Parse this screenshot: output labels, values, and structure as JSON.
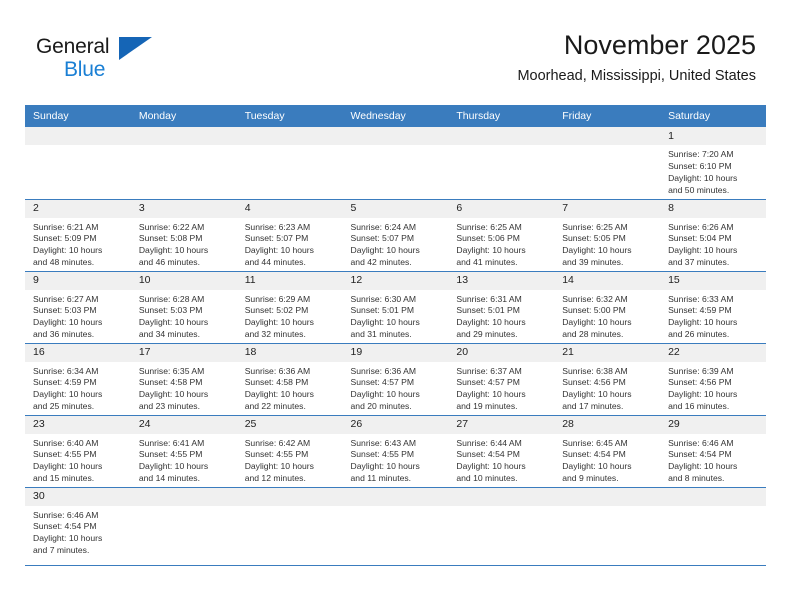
{
  "logo": {
    "word_top": "General",
    "word_bottom": "Blue",
    "triangle_icon": "blue-triangle-icon",
    "accent_dark": "#1565b6",
    "accent_light": "#1a7fd4"
  },
  "header": {
    "title": "November 2025",
    "subtitle": "Moorhead, Mississippi, United States"
  },
  "theme": {
    "header_row_bg": "#3a7cbe",
    "daynum_band_bg": "#f0f0f0",
    "row_border": "#3a7cbe",
    "text": "#333333"
  },
  "weekdays": [
    "Sunday",
    "Monday",
    "Tuesday",
    "Wednesday",
    "Thursday",
    "Friday",
    "Saturday"
  ],
  "labels": {
    "sunrise": "Sunrise:",
    "sunset": "Sunset:",
    "daylight": "Daylight:"
  },
  "weeks": [
    [
      {
        "day": "",
        "empty": true
      },
      {
        "day": "",
        "empty": true
      },
      {
        "day": "",
        "empty": true
      },
      {
        "day": "",
        "empty": true
      },
      {
        "day": "",
        "empty": true
      },
      {
        "day": "",
        "empty": true
      },
      {
        "day": "1",
        "sunrise": "Sunrise: 7:20 AM",
        "sunset": "Sunset: 6:10 PM",
        "daylight_1": "Daylight: 10 hours",
        "daylight_2": "and 50 minutes."
      }
    ],
    [
      {
        "day": "2",
        "sunrise": "Sunrise: 6:21 AM",
        "sunset": "Sunset: 5:09 PM",
        "daylight_1": "Daylight: 10 hours",
        "daylight_2": "and 48 minutes."
      },
      {
        "day": "3",
        "sunrise": "Sunrise: 6:22 AM",
        "sunset": "Sunset: 5:08 PM",
        "daylight_1": "Daylight: 10 hours",
        "daylight_2": "and 46 minutes."
      },
      {
        "day": "4",
        "sunrise": "Sunrise: 6:23 AM",
        "sunset": "Sunset: 5:07 PM",
        "daylight_1": "Daylight: 10 hours",
        "daylight_2": "and 44 minutes."
      },
      {
        "day": "5",
        "sunrise": "Sunrise: 6:24 AM",
        "sunset": "Sunset: 5:07 PM",
        "daylight_1": "Daylight: 10 hours",
        "daylight_2": "and 42 minutes."
      },
      {
        "day": "6",
        "sunrise": "Sunrise: 6:25 AM",
        "sunset": "Sunset: 5:06 PM",
        "daylight_1": "Daylight: 10 hours",
        "daylight_2": "and 41 minutes."
      },
      {
        "day": "7",
        "sunrise": "Sunrise: 6:25 AM",
        "sunset": "Sunset: 5:05 PM",
        "daylight_1": "Daylight: 10 hours",
        "daylight_2": "and 39 minutes."
      },
      {
        "day": "8",
        "sunrise": "Sunrise: 6:26 AM",
        "sunset": "Sunset: 5:04 PM",
        "daylight_1": "Daylight: 10 hours",
        "daylight_2": "and 37 minutes."
      }
    ],
    [
      {
        "day": "9",
        "sunrise": "Sunrise: 6:27 AM",
        "sunset": "Sunset: 5:03 PM",
        "daylight_1": "Daylight: 10 hours",
        "daylight_2": "and 36 minutes."
      },
      {
        "day": "10",
        "sunrise": "Sunrise: 6:28 AM",
        "sunset": "Sunset: 5:03 PM",
        "daylight_1": "Daylight: 10 hours",
        "daylight_2": "and 34 minutes."
      },
      {
        "day": "11",
        "sunrise": "Sunrise: 6:29 AM",
        "sunset": "Sunset: 5:02 PM",
        "daylight_1": "Daylight: 10 hours",
        "daylight_2": "and 32 minutes."
      },
      {
        "day": "12",
        "sunrise": "Sunrise: 6:30 AM",
        "sunset": "Sunset: 5:01 PM",
        "daylight_1": "Daylight: 10 hours",
        "daylight_2": "and 31 minutes."
      },
      {
        "day": "13",
        "sunrise": "Sunrise: 6:31 AM",
        "sunset": "Sunset: 5:01 PM",
        "daylight_1": "Daylight: 10 hours",
        "daylight_2": "and 29 minutes."
      },
      {
        "day": "14",
        "sunrise": "Sunrise: 6:32 AM",
        "sunset": "Sunset: 5:00 PM",
        "daylight_1": "Daylight: 10 hours",
        "daylight_2": "and 28 minutes."
      },
      {
        "day": "15",
        "sunrise": "Sunrise: 6:33 AM",
        "sunset": "Sunset: 4:59 PM",
        "daylight_1": "Daylight: 10 hours",
        "daylight_2": "and 26 minutes."
      }
    ],
    [
      {
        "day": "16",
        "sunrise": "Sunrise: 6:34 AM",
        "sunset": "Sunset: 4:59 PM",
        "daylight_1": "Daylight: 10 hours",
        "daylight_2": "and 25 minutes."
      },
      {
        "day": "17",
        "sunrise": "Sunrise: 6:35 AM",
        "sunset": "Sunset: 4:58 PM",
        "daylight_1": "Daylight: 10 hours",
        "daylight_2": "and 23 minutes."
      },
      {
        "day": "18",
        "sunrise": "Sunrise: 6:36 AM",
        "sunset": "Sunset: 4:58 PM",
        "daylight_1": "Daylight: 10 hours",
        "daylight_2": "and 22 minutes."
      },
      {
        "day": "19",
        "sunrise": "Sunrise: 6:36 AM",
        "sunset": "Sunset: 4:57 PM",
        "daylight_1": "Daylight: 10 hours",
        "daylight_2": "and 20 minutes."
      },
      {
        "day": "20",
        "sunrise": "Sunrise: 6:37 AM",
        "sunset": "Sunset: 4:57 PM",
        "daylight_1": "Daylight: 10 hours",
        "daylight_2": "and 19 minutes."
      },
      {
        "day": "21",
        "sunrise": "Sunrise: 6:38 AM",
        "sunset": "Sunset: 4:56 PM",
        "daylight_1": "Daylight: 10 hours",
        "daylight_2": "and 17 minutes."
      },
      {
        "day": "22",
        "sunrise": "Sunrise: 6:39 AM",
        "sunset": "Sunset: 4:56 PM",
        "daylight_1": "Daylight: 10 hours",
        "daylight_2": "and 16 minutes."
      }
    ],
    [
      {
        "day": "23",
        "sunrise": "Sunrise: 6:40 AM",
        "sunset": "Sunset: 4:55 PM",
        "daylight_1": "Daylight: 10 hours",
        "daylight_2": "and 15 minutes."
      },
      {
        "day": "24",
        "sunrise": "Sunrise: 6:41 AM",
        "sunset": "Sunset: 4:55 PM",
        "daylight_1": "Daylight: 10 hours",
        "daylight_2": "and 14 minutes."
      },
      {
        "day": "25",
        "sunrise": "Sunrise: 6:42 AM",
        "sunset": "Sunset: 4:55 PM",
        "daylight_1": "Daylight: 10 hours",
        "daylight_2": "and 12 minutes."
      },
      {
        "day": "26",
        "sunrise": "Sunrise: 6:43 AM",
        "sunset": "Sunset: 4:55 PM",
        "daylight_1": "Daylight: 10 hours",
        "daylight_2": "and 11 minutes."
      },
      {
        "day": "27",
        "sunrise": "Sunrise: 6:44 AM",
        "sunset": "Sunset: 4:54 PM",
        "daylight_1": "Daylight: 10 hours",
        "daylight_2": "and 10 minutes."
      },
      {
        "day": "28",
        "sunrise": "Sunrise: 6:45 AM",
        "sunset": "Sunset: 4:54 PM",
        "daylight_1": "Daylight: 10 hours",
        "daylight_2": "and 9 minutes."
      },
      {
        "day": "29",
        "sunrise": "Sunrise: 6:46 AM",
        "sunset": "Sunset: 4:54 PM",
        "daylight_1": "Daylight: 10 hours",
        "daylight_2": "and 8 minutes."
      }
    ],
    [
      {
        "day": "30",
        "sunrise": "Sunrise: 6:46 AM",
        "sunset": "Sunset: 4:54 PM",
        "daylight_1": "Daylight: 10 hours",
        "daylight_2": "and 7 minutes."
      },
      {
        "day": "",
        "empty": true
      },
      {
        "day": "",
        "empty": true
      },
      {
        "day": "",
        "empty": true
      },
      {
        "day": "",
        "empty": true
      },
      {
        "day": "",
        "empty": true
      },
      {
        "day": "",
        "empty": true
      }
    ]
  ]
}
